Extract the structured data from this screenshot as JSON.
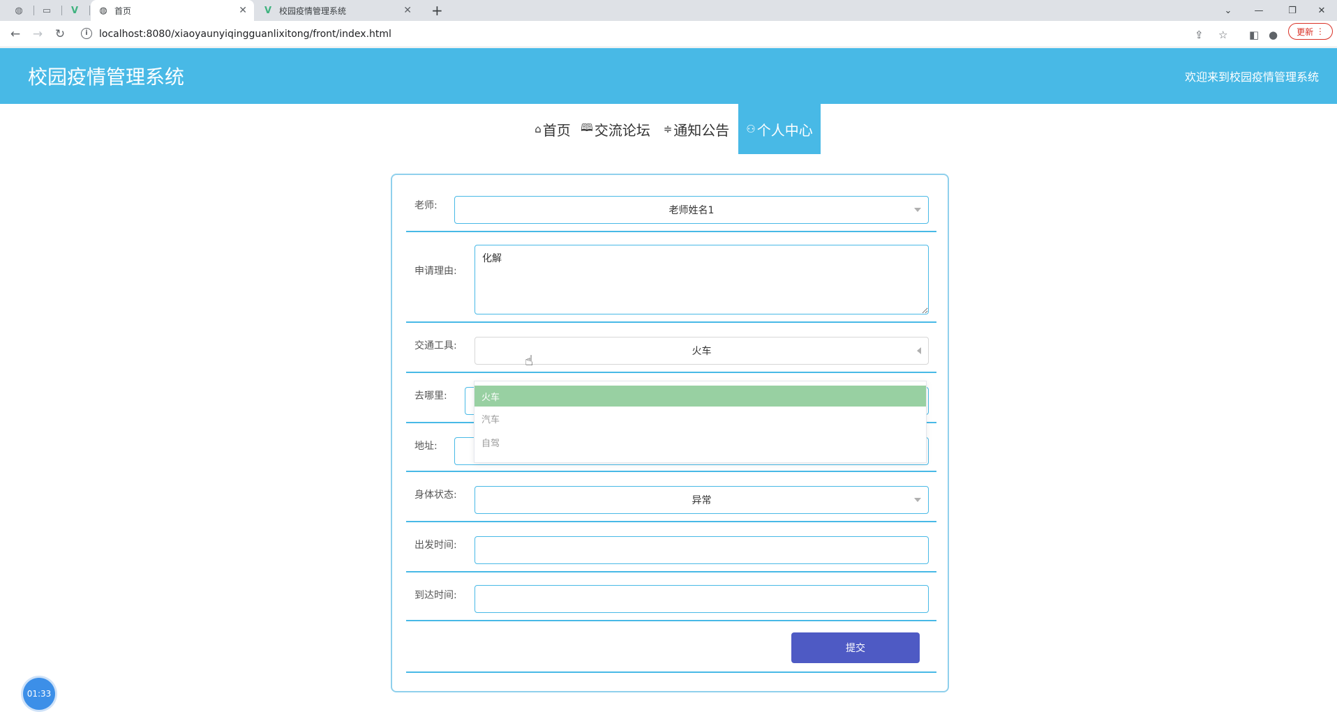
{
  "browser": {
    "tabs": [
      {
        "title": "首页",
        "icon": "globe-icon",
        "active": true
      },
      {
        "title": "校园疫情管理系统",
        "icon": "vue-logo-icon",
        "active": false
      }
    ],
    "url": "localhost:8080/xiaoyaunyiqingguanlixitong/front/index.html",
    "update_label": "更新"
  },
  "header": {
    "title": "校园疫情管理系统",
    "welcome": "欢迎来到校园疫情管理系统",
    "color": "#48b9e6"
  },
  "nav": {
    "items": [
      {
        "label": "首页",
        "icon": "home-icon"
      },
      {
        "label": "交流论坛",
        "icon": "book-icon"
      },
      {
        "label": "通知公告",
        "icon": "filter-icon"
      },
      {
        "label": "个人中心",
        "icon": "user-icon",
        "active": true
      }
    ]
  },
  "form": {
    "teacher": {
      "label": "老师:",
      "value": "老师姓名1"
    },
    "reason": {
      "label": "申请理由:",
      "value": "化解"
    },
    "transport": {
      "label": "交通工具:",
      "value": "火车",
      "options": [
        "火车",
        "汽车",
        "自驾"
      ],
      "selected": "火车"
    },
    "destination": {
      "label": "去哪里:",
      "value": ""
    },
    "address": {
      "label": "地址:",
      "value": ""
    },
    "health": {
      "label": "身体状态:",
      "value": "异常"
    },
    "depart_time": {
      "label": "出发时间:",
      "value": ""
    },
    "arrive_time": {
      "label": "到达时间:",
      "value": ""
    },
    "submit_label": "提交"
  },
  "timer": "01:33",
  "colors": {
    "accent": "#48b9e6",
    "submit": "#4e5ac4",
    "selected_option": "#98d0a2"
  }
}
